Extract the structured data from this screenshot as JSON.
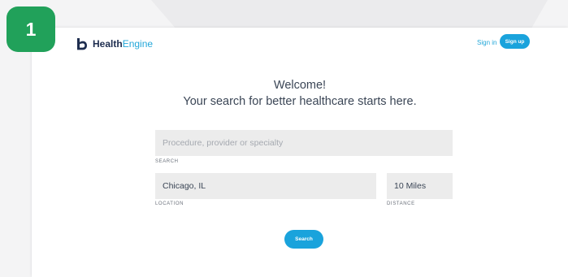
{
  "step_badge": "1",
  "header": {
    "logo": {
      "part1": "Health",
      "part2": "Engine"
    },
    "sign_in": "Sign in",
    "sign_up": "Sign up"
  },
  "hero": {
    "welcome": "Welcome!",
    "tagline": "Your search for better healthcare starts here."
  },
  "form": {
    "search": {
      "placeholder": "Procedure, provider or specialty",
      "label": "SEARCH"
    },
    "location": {
      "value": "Chicago, IL",
      "label": "LOCATION"
    },
    "distance": {
      "value": "10 Miles",
      "label": "DISTANCE"
    },
    "submit_label": "Search"
  },
  "colors": {
    "brand_blue": "#1aa3dc",
    "brand_navy": "#1e2d4f",
    "badge_green": "#21a15a"
  }
}
